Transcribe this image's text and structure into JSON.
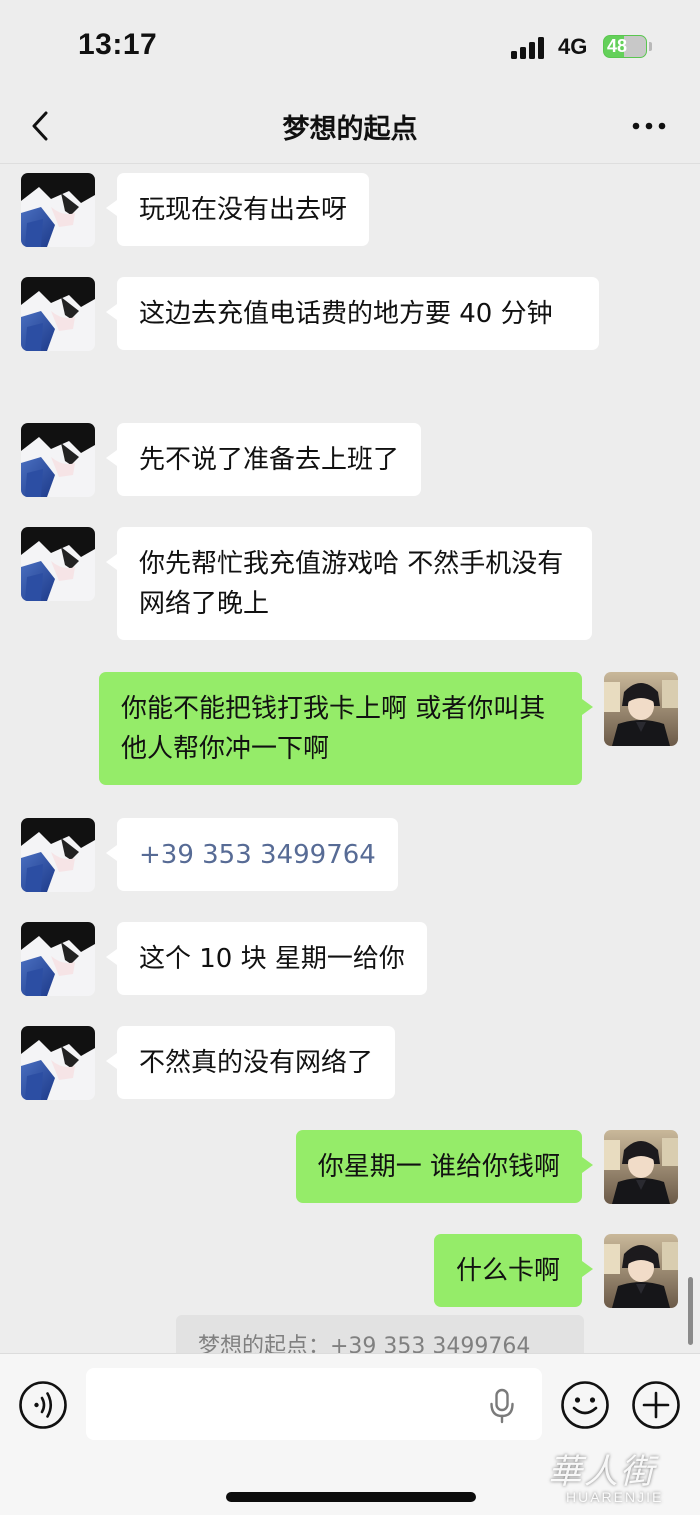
{
  "status_bar": {
    "time": "13:17",
    "network": "4G",
    "battery_percent": "48",
    "battery_level": 0.48
  },
  "nav": {
    "title": "梦想的起点",
    "back_icon": "chevron-left-icon",
    "more_icon": "more-dots-icon"
  },
  "messages": [
    {
      "side": "in",
      "text": "玩现在没有出去呀"
    },
    {
      "side": "in",
      "text": "这边去充值电话费的地方要 40 分钟"
    },
    {
      "side": "in",
      "text": "先不说了准备去上班了"
    },
    {
      "side": "in",
      "text": "你先帮忙我充值游戏哈 不然手机没有网络了晚上"
    },
    {
      "side": "out",
      "text": "你能不能把钱打我卡上啊  或者你叫其他人帮你冲一下啊"
    },
    {
      "side": "in",
      "text": "+39 353 3499764"
    },
    {
      "side": "in",
      "text": "这个 10 块 星期一给你"
    },
    {
      "side": "in",
      "text": "不然真的没有网络了"
    },
    {
      "side": "out",
      "text": "你星期一  谁给你钱啊"
    },
    {
      "side": "out",
      "text": "什么卡啊"
    }
  ],
  "quote": {
    "text": "梦想的起点：+39 353 3499764"
  },
  "input_bar": {
    "value": "",
    "placeholder": "",
    "icons": [
      "voice-icon",
      "mic-icon",
      "emoji-icon",
      "plus-icon"
    ]
  },
  "watermark": {
    "cn": "華人街",
    "en": "HUARENJIE"
  },
  "colors": {
    "background": "#ededed",
    "incoming_bubble": "#ffffff",
    "outgoing_bubble": "#95ec69",
    "link": "#576b95",
    "battery": "#64d05a"
  }
}
